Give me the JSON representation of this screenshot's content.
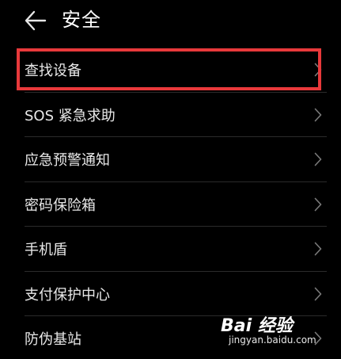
{
  "header": {
    "back_icon": "arrow-left-icon",
    "title": "安全"
  },
  "items": [
    {
      "label": "查找设备",
      "icon": "chevron-right-icon",
      "highlighted": true
    },
    {
      "label": "SOS 紧急求助",
      "icon": "chevron-right-icon"
    },
    {
      "label": "应急预警通知",
      "icon": "chevron-right-icon"
    },
    {
      "label": "密码保险箱",
      "icon": "chevron-right-icon"
    },
    {
      "label": "手机盾",
      "icon": "chevron-right-icon"
    },
    {
      "label": "支付保护中心",
      "icon": "chevron-right-icon"
    },
    {
      "label": "防伪基站",
      "icon": "chevron-right-icon"
    }
  ],
  "watermark": {
    "brand": "Bai 经验",
    "url": "jingyan.baidu.com"
  },
  "colors": {
    "background": "#000000",
    "highlight_border": "#e8393b",
    "text": "#e8e8e8"
  }
}
